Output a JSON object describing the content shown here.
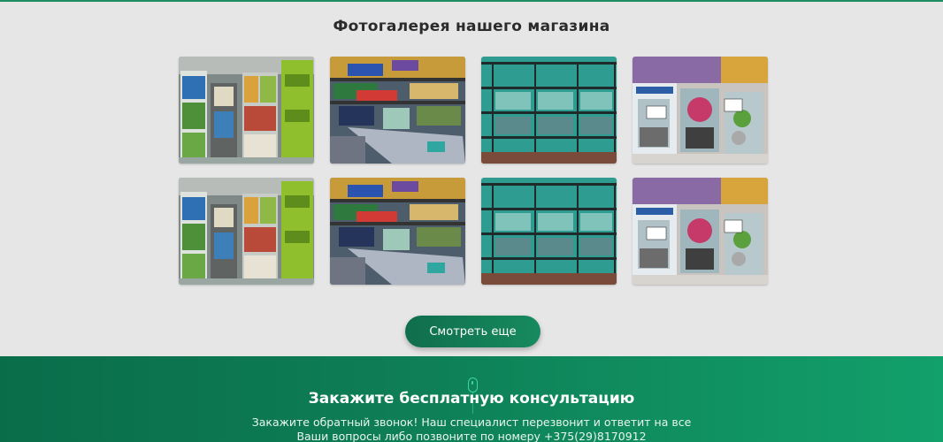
{
  "gallery": {
    "title": "Фотогалерея нашего магазина",
    "photos": [
      {
        "subject": "shop-shelves-with-aquarium-filters-boxes"
      },
      {
        "subject": "shop-display-with-decorations-and-tanks"
      },
      {
        "subject": "shop-racks-of-empty-aquariums"
      },
      {
        "subject": "planted-aquariums-with-price-tags"
      },
      {
        "subject": "shop-shelves-with-aquarium-filters-boxes"
      },
      {
        "subject": "shop-display-with-decorations-and-tanks"
      },
      {
        "subject": "shop-racks-of-empty-aquariums"
      },
      {
        "subject": "planted-aquariums-with-price-tags"
      }
    ],
    "more_button": "Смотреть еще"
  },
  "consultation": {
    "title": "Закажите бесплатную консультацию",
    "text_line1": "Закажите обратный звонок! Наш специалист перезвонит и ответит на все",
    "text_line2": "Ваши вопросы либо позвоните по номеру +375(29)8170912",
    "scroll_icon": "mouse-scroll-icon"
  },
  "colors": {
    "accent_dark": "#0f6e4d",
    "accent_light": "#12a06b",
    "page_bg": "#e6e6e6"
  }
}
